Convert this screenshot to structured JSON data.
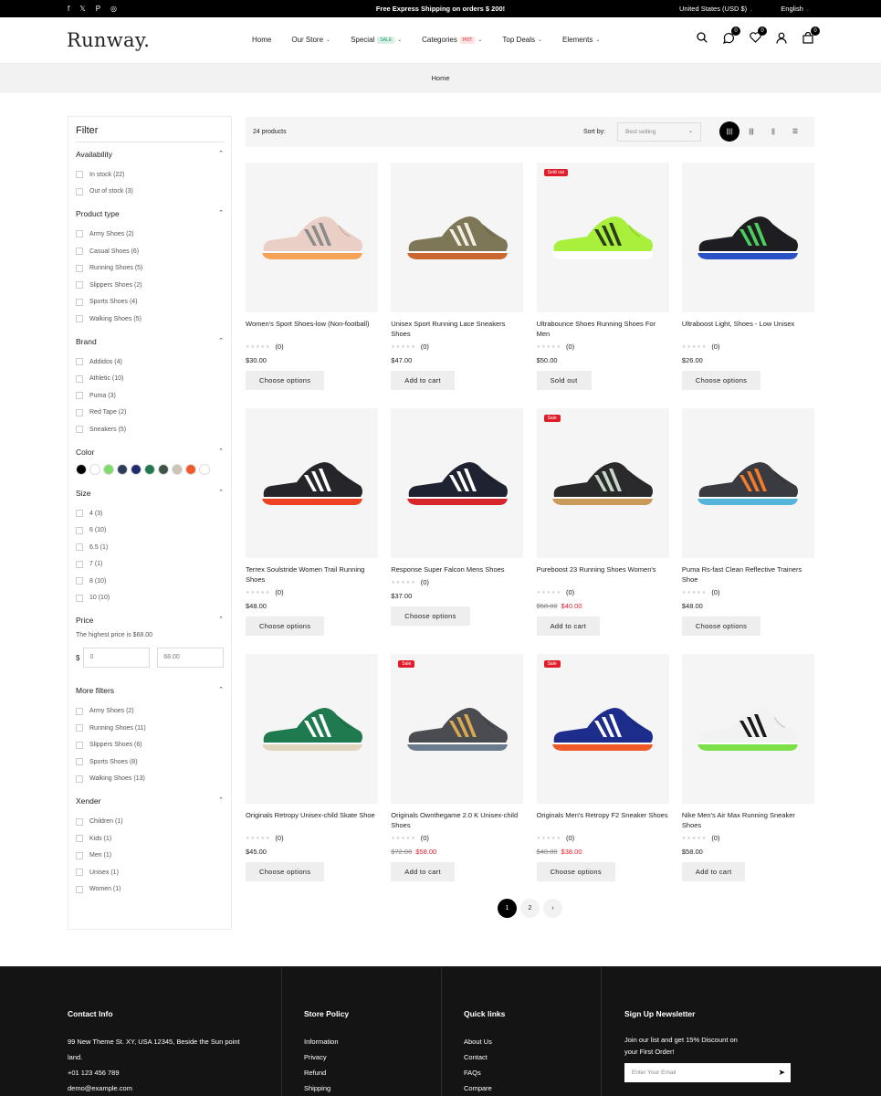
{
  "announcement": {
    "social": [
      "f",
      "𝕏",
      "P",
      "◎"
    ],
    "text": "Free Express Shipping on orders $ 200!",
    "currency": "United States (USD $)",
    "language": "English"
  },
  "header": {
    "logo": "Runway.",
    "nav": [
      {
        "label": "Home",
        "badge": null,
        "caret": false
      },
      {
        "label": "Our Store",
        "badge": null,
        "caret": true
      },
      {
        "label": "Special",
        "badge": "SALE",
        "badge_bg": "#d8f0e6",
        "badge_color": "#2a9d6a",
        "caret": true
      },
      {
        "label": "Categories",
        "badge": "HOT",
        "badge_bg": "#fde2e2",
        "badge_color": "#e01e2b",
        "caret": true
      },
      {
        "label": "Top Deals",
        "badge": null,
        "caret": true
      },
      {
        "label": "Elements",
        "badge": null,
        "caret": true
      }
    ],
    "icons": [
      {
        "name": "search-icon",
        "count": null
      },
      {
        "name": "compare-icon",
        "count": "0"
      },
      {
        "name": "wishlist-icon",
        "count": "0"
      },
      {
        "name": "account-icon",
        "count": null
      },
      {
        "name": "cart-icon",
        "count": "0"
      }
    ]
  },
  "breadcrumb": "Home",
  "filter": {
    "title": "Filter",
    "availability": {
      "title": "Availability",
      "options": [
        "In stock (22)",
        "Out of stock (3)"
      ]
    },
    "product_type": {
      "title": "Product type",
      "options": [
        "Army Shoes (2)",
        "Casual Shoes (6)",
        "Running Shoes (5)",
        "Slippers Shoes (2)",
        "Sports Shoes (4)",
        "Walking Shoes (5)"
      ]
    },
    "brand": {
      "title": "Brand",
      "options": [
        "Addidos (4)",
        "Athletic (10)",
        "Puma (3)",
        "Red Tape (2)",
        "Sneakers (5)"
      ]
    },
    "color": {
      "title": "Color",
      "swatches": [
        "#000000",
        "#ffffff",
        "#7ddc6a",
        "#2f3b5c",
        "#1d2d6b",
        "#1f7a4f",
        "#3f5447",
        "#c9c4b6",
        "#f05a28",
        "#ffffff"
      ]
    },
    "size": {
      "title": "Size",
      "options": [
        "4 (3)",
        "6 (10)",
        "6.5 (1)",
        "7 (1)",
        "8 (10)",
        "10 (10)"
      ]
    },
    "price": {
      "title": "Price",
      "note": "The highest price is $68.00",
      "currency": "$",
      "min": "0",
      "max": "68.00"
    },
    "more_filters": {
      "title": "More filters",
      "options": [
        "Army Shoes (2)",
        "Running Shoes (11)",
        "Slippers Shoes (6)",
        "Sports Shoes (8)",
        "Walking Shoes (13)"
      ]
    },
    "xender": {
      "title": "Xender",
      "options": [
        "Children (1)",
        "Kids (1)",
        "Men (1)",
        "Unisex (1)",
        "Women (1)"
      ]
    }
  },
  "toolbar": {
    "count": "24 products",
    "sort_label": "Sort by:",
    "sort_value": "Best selling",
    "views": [
      "grid-4-view-icon",
      "grid-3-view-icon",
      "grid-2-view-icon",
      "list-view-icon"
    ]
  },
  "products": [
    {
      "name": "Women's Sport Shoes-low (Non-football)",
      "reviews": "(0)",
      "price": "$30.00",
      "old_price": null,
      "tag": null,
      "button": "Choose options",
      "shoe": {
        "upper": "#e9cfc6",
        "accent": "#8a8a8a",
        "sole": "#f6a35a"
      }
    },
    {
      "name": "Unisex Sport Running Lace Sneakers Shoes",
      "reviews": "(0)",
      "price": "$47.00",
      "old_price": null,
      "tag": null,
      "button": "Add to cart",
      "shoe": {
        "upper": "#7d7758",
        "accent": "#f2efe2",
        "sole": "#c9672e"
      }
    },
    {
      "name": "Ultrabounce Shoes Running Shoes For Men",
      "reviews": "(0)",
      "price": "$50.00",
      "old_price": null,
      "tag": "Sold out",
      "button": "Sold out",
      "shoe": {
        "upper": "#a8f03c",
        "accent": "#2b3a1e",
        "sole": "#ffffff"
      }
    },
    {
      "name": "Ultraboost Light, Shoes - Low Unisex",
      "reviews": "(0)",
      "price": "$26.00",
      "old_price": null,
      "tag": null,
      "button": "Choose options",
      "shoe": {
        "upper": "#1e1e22",
        "accent": "#4ccf5d",
        "sole": "#2952c7"
      }
    },
    {
      "name": "Terrex Soulstride Women Trail Running Shoes",
      "reviews": "(0)",
      "price": "$48.00",
      "old_price": null,
      "tag": null,
      "button": "Choose options",
      "shoe": {
        "upper": "#26262a",
        "accent": "#ffffff",
        "sole": "#ef4123"
      }
    },
    {
      "name": "Response Super Falcon Mens Shoes",
      "reviews": "(0)",
      "price": "$37.00",
      "old_price": null,
      "tag": null,
      "button": "Choose options",
      "shoe": {
        "upper": "#1f2230",
        "accent": "#ffffff",
        "sole": "#d6262b"
      }
    },
    {
      "name": "Pureboost 23 Running Shoes Women's",
      "reviews": "(0)",
      "price": "$40.00",
      "old_price": "$58.00",
      "tag": "Sale",
      "button": "Add to cart",
      "shoe": {
        "upper": "#2a2a2c",
        "accent": "#c7d6c8",
        "sole": "#c99a5a"
      }
    },
    {
      "name": "Puma Rs-fast Clean Reflective Trainers Shoe",
      "reviews": "(0)",
      "price": "$48.00",
      "old_price": null,
      "tag": null,
      "button": "Choose options",
      "shoe": {
        "upper": "#3a3b40",
        "accent": "#f37b2a",
        "sole": "#55b4d9"
      }
    },
    {
      "name": "Originals Retropy Unisex-child Skate Shoe",
      "reviews": "(0)",
      "price": "$45.00",
      "old_price": null,
      "tag": null,
      "button": "Choose options",
      "shoe": {
        "upper": "#1f7a4f",
        "accent": "#ffffff",
        "sole": "#e0d6c0"
      }
    },
    {
      "name": "Originals Ownthegame 2.0 K Unisex-child Shoes",
      "reviews": "(0)",
      "price": "$58.00",
      "old_price": "$72.00",
      "tag": "Sale",
      "button": "Add to cart",
      "shoe": {
        "upper": "#4a4c52",
        "accent": "#d9a94e",
        "sole": "#6b7a8c"
      }
    },
    {
      "name": "Originals Men's Retropy F2 Sneaker Shoes",
      "reviews": "(0)",
      "price": "$38.00",
      "old_price": "$48.00",
      "tag": "Sale",
      "button": "Choose options",
      "shoe": {
        "upper": "#1d2d8c",
        "accent": "#ffffff",
        "sole": "#f05a28"
      }
    },
    {
      "name": "Nike Men's Air Max Running Sneaker Shoes",
      "reviews": "(0)",
      "price": "$58.00",
      "old_price": null,
      "tag": null,
      "button": "Add to cart",
      "shoe": {
        "upper": "#f2f2f2",
        "accent": "#1a1a1a",
        "sole": "#7de04a"
      }
    }
  ],
  "pagination": {
    "pages": [
      "1",
      "2"
    ],
    "next": "›"
  },
  "footer": {
    "contact": {
      "title": "Contact Info",
      "address": "99 New Theme St. XY, USA 12345, Beside the Sun point land.",
      "phone": "+01 123 456 789",
      "email": "demo@example.com"
    },
    "policy": {
      "title": "Store Policy",
      "links": [
        "Information",
        "Privacy",
        "Refund",
        "Shipping"
      ]
    },
    "quick": {
      "title": "Quick links",
      "links": [
        "About Us",
        "Contact",
        "FAQs",
        "Compare"
      ]
    },
    "newsletter": {
      "title": "Sign Up Newsletter",
      "text": "Join our list and get 15% Discount on your First Order!",
      "placeholder": "Enter Your Email"
    }
  }
}
